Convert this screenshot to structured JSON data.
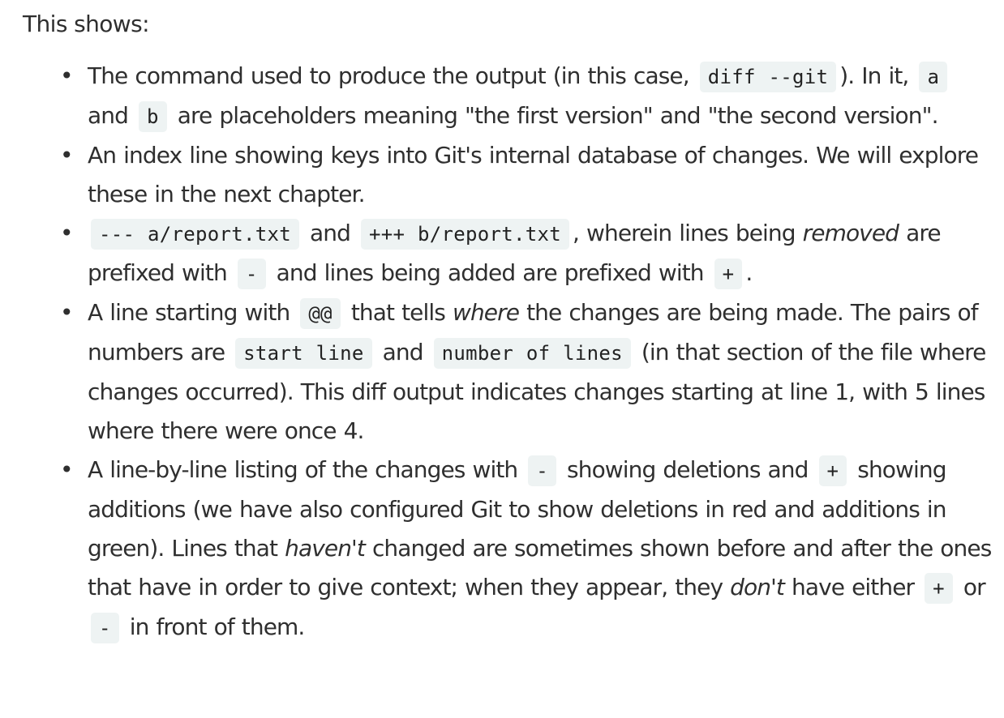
{
  "intro": "This shows:",
  "items": [
    {
      "t1": "The command used to produce the output (in this case, ",
      "c1": "diff --git",
      "t2": "). In it, ",
      "c2": "a",
      "t3": " and ",
      "c3": "b",
      "t4": " are placeholders meaning \"the first version\" and \"the second version\"."
    },
    {
      "t1": "An index line showing keys into Git's internal database of changes. We will explore these in the next chapter."
    },
    {
      "c1": "--- a/report.txt",
      "t1": " and ",
      "c2": "+++ b/report.txt",
      "t2": ", wherein lines being ",
      "em1": "removed",
      "t3": " are prefixed with ",
      "c3": "-",
      "t4": " and lines being added are prefixed with ",
      "c4": "+",
      "t5": "."
    },
    {
      "t1": "A line starting with ",
      "c1": "@@",
      "t2": " that tells ",
      "em1": "where",
      "t3": " the changes are being made. The pairs of numbers are ",
      "c2": "start line",
      "t4": " and ",
      "c3": "number of lines",
      "t5": " (in that section of the file where changes occurred). This diff output indicates changes starting at line 1, with 5 lines where there were once 4."
    },
    {
      "t1": "A line-by-line listing of the changes with ",
      "c1": "-",
      "t2": " showing deletions and ",
      "c2": "+",
      "t3": " showing additions (we have also configured Git to show deletions in red and additions in green). Lines that ",
      "em1": "haven't",
      "t4": " changed are sometimes shown before and after the ones that have in order to give context; when they appear, they ",
      "em2": "don't",
      "t5": " have either ",
      "c3": "+",
      "t6": " or ",
      "c4": "-",
      "t7": " in front of them."
    }
  ],
  "bullet_glyph": "•"
}
